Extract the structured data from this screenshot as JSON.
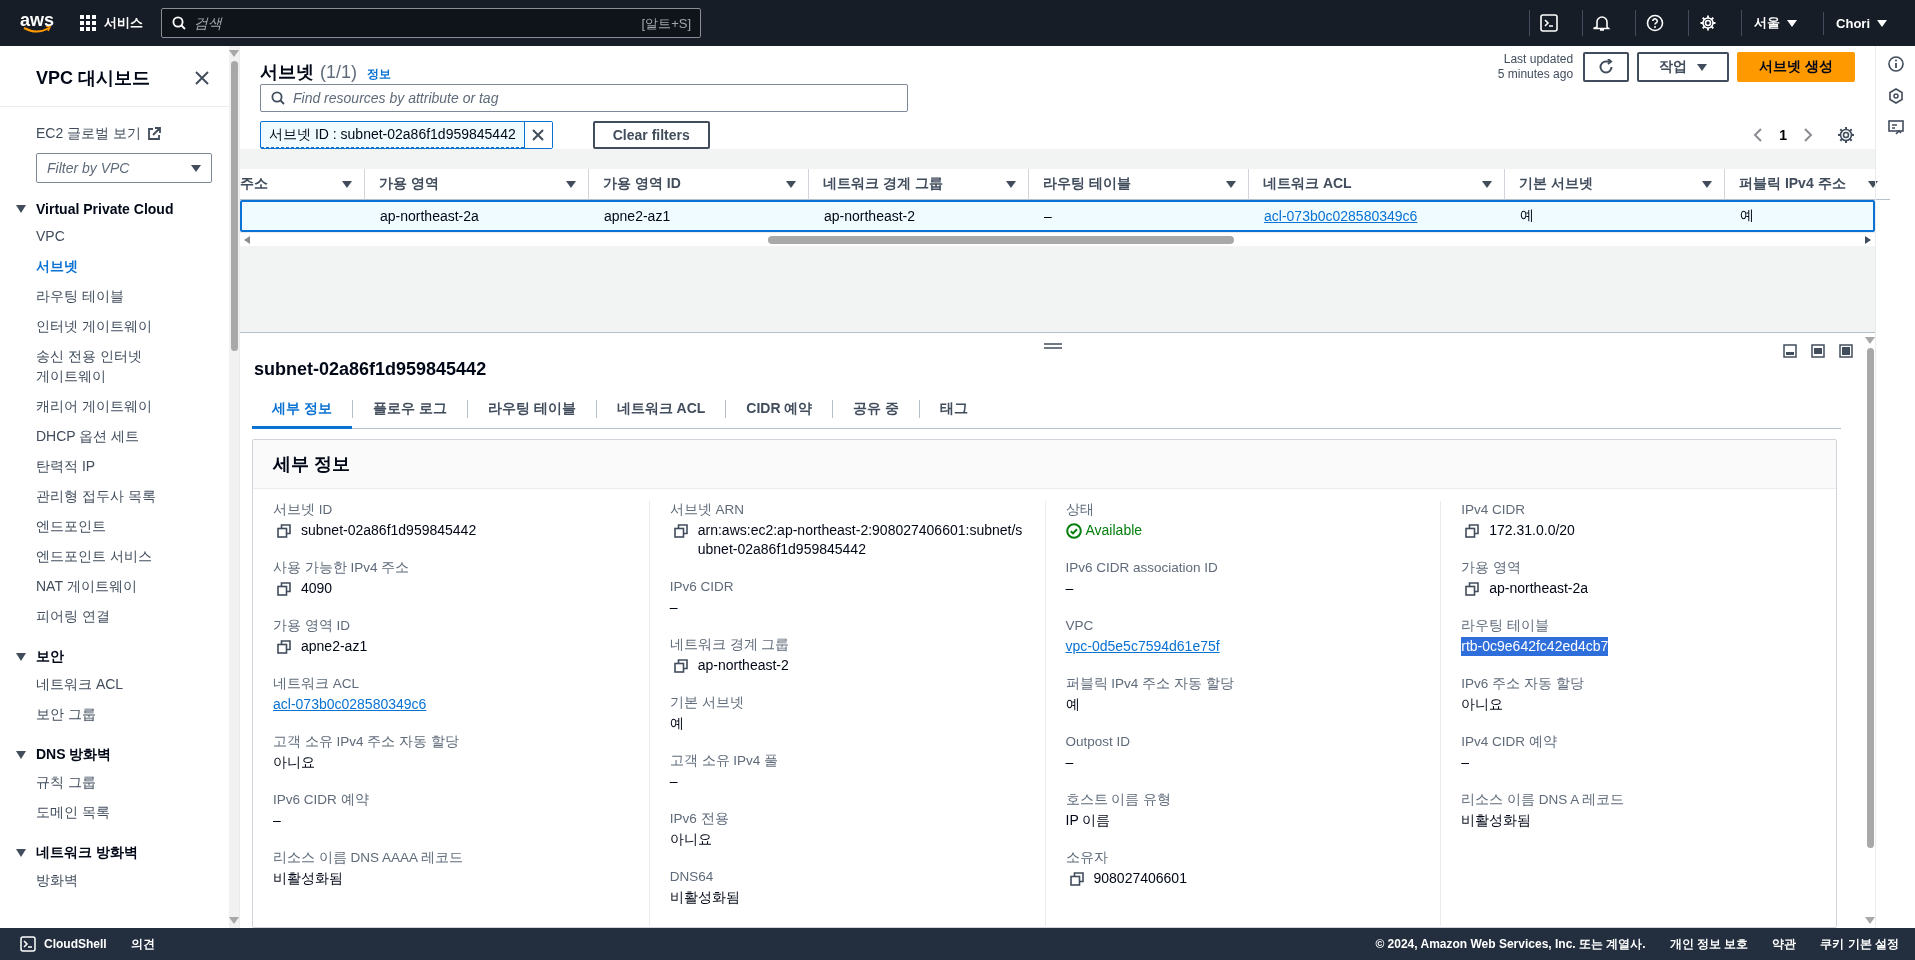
{
  "top_nav": {
    "logo": "aws",
    "services_label": "서비스",
    "search": {
      "placeholder": "검색",
      "shortcut": "[알트+S]"
    },
    "region": "서울",
    "user": "Chori"
  },
  "sidebar": {
    "title": "VPC 대시보드",
    "ec2_link": "EC2 글로벌 보기",
    "vpc_filter": {
      "placeholder": "Filter by VPC"
    },
    "sections": [
      {
        "label": "Virtual Private Cloud",
        "expanded": true,
        "items": [
          {
            "label": "VPC",
            "selected": false
          },
          {
            "label": "서브넷",
            "selected": true
          },
          {
            "label": "라우팅 테이블",
            "selected": false
          },
          {
            "label": "인터넷 게이트웨이",
            "selected": false
          },
          {
            "label": "송신 전용 인터넷 게이트웨이",
            "selected": false
          },
          {
            "label": "캐리어 게이트웨이",
            "selected": false
          },
          {
            "label": "DHCP 옵션 세트",
            "selected": false
          },
          {
            "label": "탄력적 IP",
            "selected": false
          },
          {
            "label": "관리형 접두사 목록",
            "selected": false
          },
          {
            "label": "엔드포인트",
            "selected": false
          },
          {
            "label": "엔드포인트 서비스",
            "selected": false
          },
          {
            "label": "NAT 게이트웨이",
            "selected": false
          },
          {
            "label": "피어링 연결",
            "selected": false
          }
        ]
      },
      {
        "label": "보안",
        "expanded": true,
        "items": [
          {
            "label": "네트워크 ACL",
            "selected": false
          },
          {
            "label": "보안 그룹",
            "selected": false
          }
        ]
      },
      {
        "label": "DNS 방화벽",
        "expanded": true,
        "items": [
          {
            "label": "규칙 그룹",
            "selected": false
          },
          {
            "label": "도메인 목록",
            "selected": false
          }
        ]
      },
      {
        "label": "네트워크 방화벽",
        "expanded": true,
        "items": [
          {
            "label": "방화벽",
            "selected": false
          }
        ]
      }
    ]
  },
  "list": {
    "title": "서브넷",
    "count": "(1/1)",
    "info": "정보",
    "last_updated": [
      "Last updated",
      "5 minutes ago"
    ],
    "actions_label": "작업",
    "create_label": "서브넷 생성",
    "search": {
      "placeholder": "Find resources by attribute or tag"
    },
    "filter_token": "서브넷 ID : subnet-02a86f1d959845442",
    "clear_filters": "Clear filters",
    "page": "1",
    "table": {
      "columns": [
        "주소",
        "가용 영역",
        "가용 영역 ID",
        "네트워크 경계 그룹",
        "라우팅 테이블",
        "네트워크 ACL",
        "기본 서브넷",
        "퍼블릭 IPv4 주소"
      ],
      "rows": [
        {
          "selected": true,
          "cells": [
            {
              "kind": "blank"
            },
            {
              "kind": "text",
              "text": "ap-northeast-2a"
            },
            {
              "kind": "text",
              "text": "apne2-az1"
            },
            {
              "kind": "text",
              "text": "ap-northeast-2"
            },
            {
              "kind": "text",
              "text": "–"
            },
            {
              "kind": "link",
              "text": "acl-073b0c028580349c6"
            },
            {
              "kind": "text",
              "text": "예"
            },
            {
              "kind": "text",
              "text": "예"
            }
          ]
        }
      ]
    }
  },
  "detail": {
    "resource_title": "subnet-02a86f1d959845442",
    "tabs": [
      {
        "label": "세부 정보",
        "selected": true
      },
      {
        "label": "플로우 로그",
        "selected": false
      },
      {
        "label": "라우팅 테이블",
        "selected": false
      },
      {
        "label": "네트워크 ACL",
        "selected": false
      },
      {
        "label": "CIDR 예약",
        "selected": false
      },
      {
        "label": "공유 중",
        "selected": false
      },
      {
        "label": "태그",
        "selected": false
      }
    ],
    "card_title": "세부 정보",
    "columns": [
      [
        {
          "label": "서브넷 ID",
          "value": "subnet-02a86f1d959845442",
          "kind": "copy"
        },
        {
          "label": "사용 가능한 IPv4 주소",
          "value": "4090",
          "kind": "copy"
        },
        {
          "label": "가용 영역 ID",
          "value": "apne2-az1",
          "kind": "copy"
        },
        {
          "label": "네트워크 ACL",
          "value": "acl-073b0c028580349c6",
          "kind": "link",
          "highlighted": false
        },
        {
          "label": "고객 소유 IPv4 주소 자동 할당",
          "value": "아니요",
          "kind": "plain"
        },
        {
          "label": "IPv6 CIDR 예약",
          "value": "–",
          "kind": "plain"
        },
        {
          "label": "리소스 이름 DNS AAAA 레코드",
          "value": "비활성화됨",
          "kind": "plain"
        }
      ],
      [
        {
          "label": "서브넷 ARN",
          "value": "arn:aws:ec2:ap-northeast-2:908027406601:subnet/subnet-02a86f1d959845442",
          "kind": "copy"
        },
        {
          "label": "IPv6 CIDR",
          "value": "–",
          "kind": "plain"
        },
        {
          "label": "네트워크 경계 그룹",
          "value": "ap-northeast-2",
          "kind": "copy"
        },
        {
          "label": "기본 서브넷",
          "value": "예",
          "kind": "plain"
        },
        {
          "label": "고객 소유 IPv4 풀",
          "value": "–",
          "kind": "plain"
        },
        {
          "label": "IPv6 전용",
          "value": "아니요",
          "kind": "plain"
        },
        {
          "label": "DNS64",
          "value": "비활성화됨",
          "kind": "plain"
        }
      ],
      [
        {
          "label": "상태",
          "value": "Available",
          "kind": "status"
        },
        {
          "label": "IPv6 CIDR association ID",
          "value": "–",
          "kind": "plain"
        },
        {
          "label": "VPC",
          "value": "vpc-0d5e5c7594d61e75f",
          "kind": "link",
          "highlighted": false
        },
        {
          "label": "퍼블릭 IPv4 주소 자동 할당",
          "value": "예",
          "kind": "plain"
        },
        {
          "label": "Outpost ID",
          "value": "–",
          "kind": "plain"
        },
        {
          "label": "호스트 이름 유형",
          "value": "IP 이름",
          "kind": "plain"
        },
        {
          "label": "소유자",
          "value": "908027406601",
          "kind": "copy"
        }
      ],
      [
        {
          "label": "IPv4 CIDR",
          "value": "172.31.0.0/20",
          "kind": "copy"
        },
        {
          "label": "가용 영역",
          "value": "ap-northeast-2a",
          "kind": "copy"
        },
        {
          "label": "라우팅 테이블",
          "value": "rtb-0c9e642fc42ed4cb7",
          "kind": "link",
          "highlighted": true
        },
        {
          "label": "IPv6 주소 자동 할당",
          "value": "아니요",
          "kind": "plain"
        },
        {
          "label": "IPv4 CIDR 예약",
          "value": "–",
          "kind": "plain"
        },
        {
          "label": "리소스 이름 DNS A 레코드",
          "value": "비활성화됨",
          "kind": "plain"
        }
      ]
    ]
  },
  "footer": {
    "cloudshell": "CloudShell",
    "feedback": "의견",
    "copyright": "© 2024, Amazon Web Services, Inc. 또는 계열사.",
    "links": [
      "개인 정보 보호",
      "약관",
      "쿠키 기본 설정"
    ]
  }
}
